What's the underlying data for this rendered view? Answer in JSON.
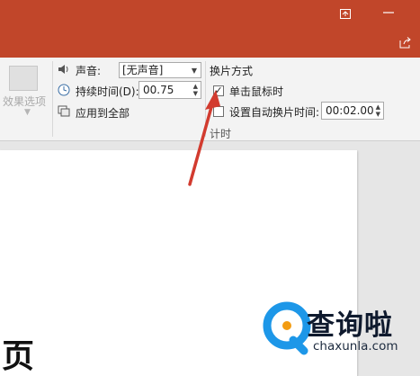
{
  "titlebar": {
    "color": "#c1462a",
    "icons": [
      "restore-icon",
      "minimize-icon",
      "share-icon"
    ]
  },
  "ribbon": {
    "effect_options": {
      "label": "效果选项"
    },
    "sound": {
      "label": "声音:",
      "value": "[无声音]"
    },
    "duration": {
      "label": "持续时间(D):",
      "value": "00.75"
    },
    "apply_all": {
      "label": "应用到全部"
    },
    "advance": {
      "header": "换片方式",
      "on_click": {
        "label": "单击鼠标时",
        "checked": true
      },
      "after": {
        "label": "设置自动换片时间:",
        "checked": false,
        "value": "00:02.00"
      }
    },
    "timing_group": "计时"
  },
  "slide": {
    "visible_text": "页"
  },
  "watermark": {
    "name": "查询啦",
    "url": "chaxunla.com",
    "accent": "#1d97e8"
  },
  "annotation": {
    "color": "#d23b2f"
  }
}
